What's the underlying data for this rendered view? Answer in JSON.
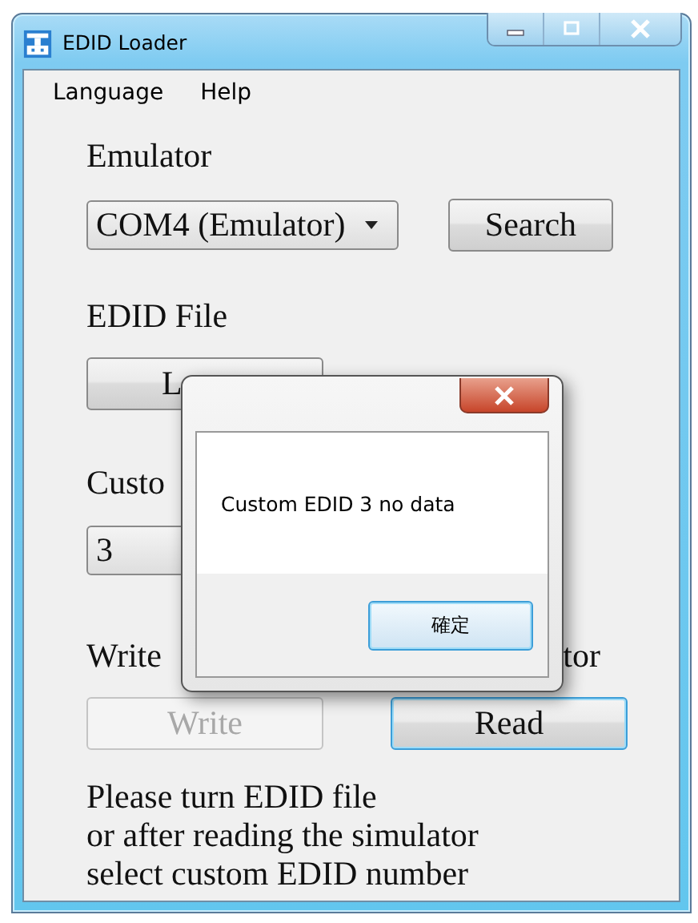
{
  "window": {
    "title": "EDID Loader"
  },
  "menu": [
    "Language",
    "Help"
  ],
  "emulator": {
    "label": "Emulator",
    "port": "COM4 (Emulator)",
    "search_button": "Search"
  },
  "edid_file": {
    "label": "EDID File",
    "load_button": "L"
  },
  "custom": {
    "label": "Custo",
    "value": "3"
  },
  "transfer": {
    "label_left": "Write",
    "label_right": "tor",
    "buttons": [
      {
        "label": "Write",
        "disabled": true,
        "focused": false
      },
      {
        "label": "Read",
        "disabled": false,
        "focused": true
      }
    ]
  },
  "hint": [
    "Please turn EDID file",
    "or after reading the simulator",
    "select custom EDID number"
  ],
  "dialog": {
    "message": "Custom EDID 3 no data",
    "ok_button": "確定"
  }
}
